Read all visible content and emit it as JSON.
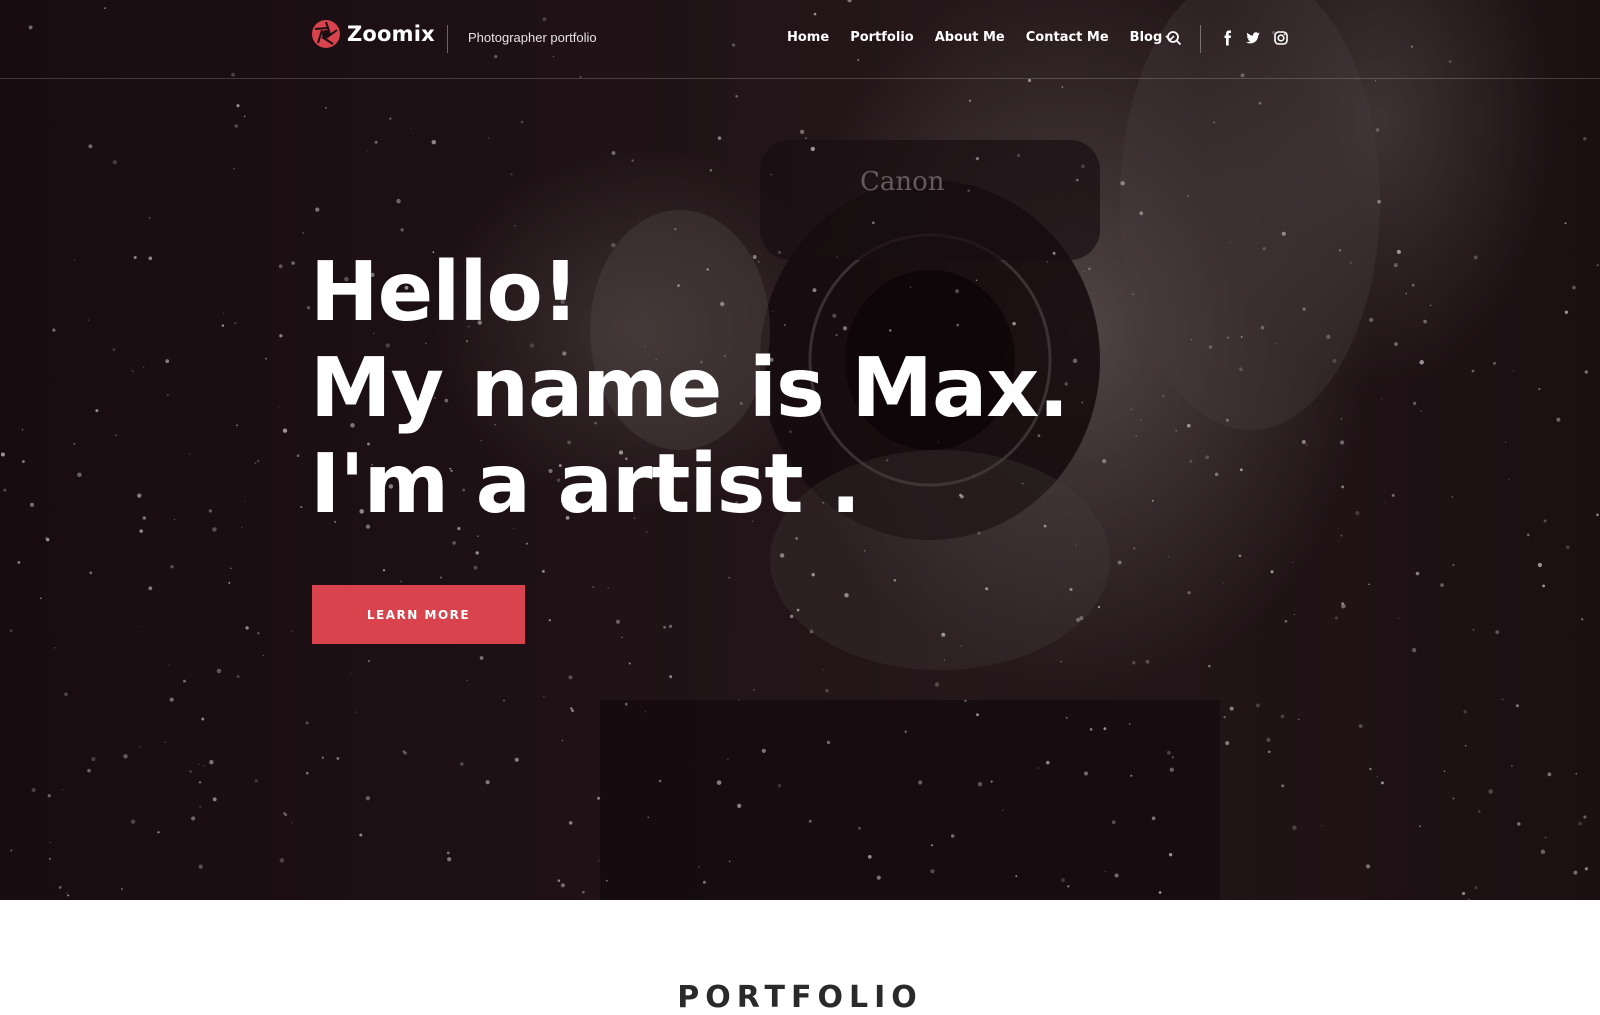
{
  "header": {
    "brand": "Zoomix",
    "tagline": "Photographer portfolio",
    "nav": [
      {
        "label": "Home"
      },
      {
        "label": "Portfolio"
      },
      {
        "label": "About Me"
      },
      {
        "label": "Contact Me"
      },
      {
        "label": "Blog",
        "dropdown": true
      }
    ],
    "icons": [
      "search-icon",
      "facebook-icon",
      "twitter-icon",
      "instagram-icon"
    ]
  },
  "hero": {
    "line1": "Hello!",
    "line2": "My name is Max.",
    "line3": "I'm a artist .",
    "cta_label": "LEARN MORE"
  },
  "portfolio": {
    "title": "PORTFOLIO"
  },
  "colors": {
    "accent": "#d8434d",
    "hero_dark": "#1a0e12"
  }
}
